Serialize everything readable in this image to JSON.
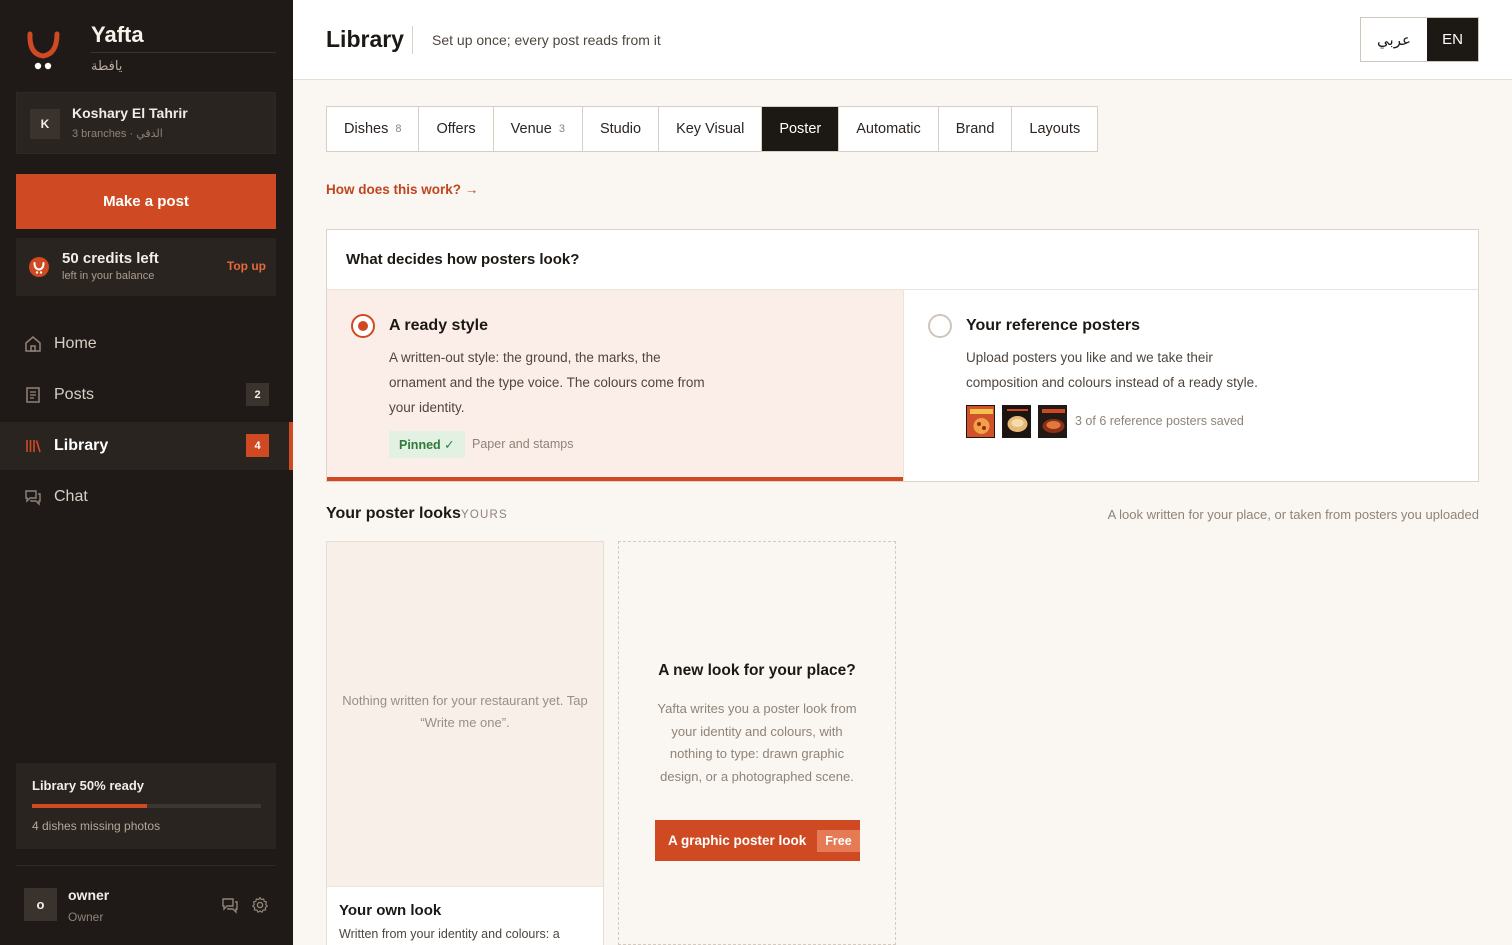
{
  "brand": {
    "name": "Yafta",
    "arabic": "يافطة",
    "accent": "#cf4a22"
  },
  "account": {
    "initial": "K",
    "name": "Koshary El Tahrir",
    "sub": "3 branches · الدقي"
  },
  "make_post": "Make a post",
  "credits": {
    "main": "50 credits left",
    "sub": "left in your balance",
    "topup": "Top up"
  },
  "nav": [
    {
      "label": "Home",
      "icon": "home-icon"
    },
    {
      "label": "Posts",
      "icon": "posts-icon",
      "badge": "2"
    },
    {
      "label": "Library",
      "icon": "library-icon",
      "badge": "4",
      "active": true
    },
    {
      "label": "Chat",
      "icon": "chat-icon"
    }
  ],
  "library_ready": {
    "title": "Library 50% ready",
    "progress": 0.5,
    "sub": "4 dishes missing photos"
  },
  "user": {
    "initial": "o",
    "name": "owner",
    "role": "Owner"
  },
  "header": {
    "title": "Library",
    "subtitle": "Set up once; every post reads from it"
  },
  "lang": {
    "ar": "عربي",
    "en": "EN",
    "selected": "EN"
  },
  "tabs": [
    {
      "label": "Dishes",
      "count": "8"
    },
    {
      "label": "Offers",
      "count": ""
    },
    {
      "label": "Venue",
      "count": "3"
    },
    {
      "label": "Studio",
      "count": ""
    },
    {
      "label": "Key Visual",
      "count": ""
    },
    {
      "label": "Poster",
      "count": "",
      "selected": true
    },
    {
      "label": "Automatic",
      "count": ""
    },
    {
      "label": "Brand",
      "count": ""
    },
    {
      "label": "Layouts",
      "count": ""
    }
  ],
  "how_link": "How does this work? →",
  "decide": {
    "question": "What decides how posters look?",
    "ready": {
      "title": "A ready style",
      "body": "A written-out style: the ground, the marks, the ornament and the type voice. The colours come from your identity.",
      "pinned": "Pinned ✓",
      "style": "Paper and stamps",
      "selected": true
    },
    "reference": {
      "title": "Your reference posters",
      "body": "Upload posters you like and we take their composition and colours instead of a ready style.",
      "count": "3 of 6 reference posters saved"
    }
  },
  "looks": {
    "title": "Your poster looks",
    "tag": "YOURS",
    "hint": "A look written for your place, or taken from posters you uploaded",
    "own": {
      "empty": "Nothing written for your restaurant yet. Tap “Write me one”.",
      "title": "Your own look",
      "sub": "Written from your identity and colours: a"
    },
    "new": {
      "title": "A new look for your place?",
      "body": "Yafta writes you a poster look from your identity and colours, with nothing to type: drawn graphic design, or a photographed scene.",
      "button": "A graphic poster look",
      "free": "Free"
    }
  }
}
